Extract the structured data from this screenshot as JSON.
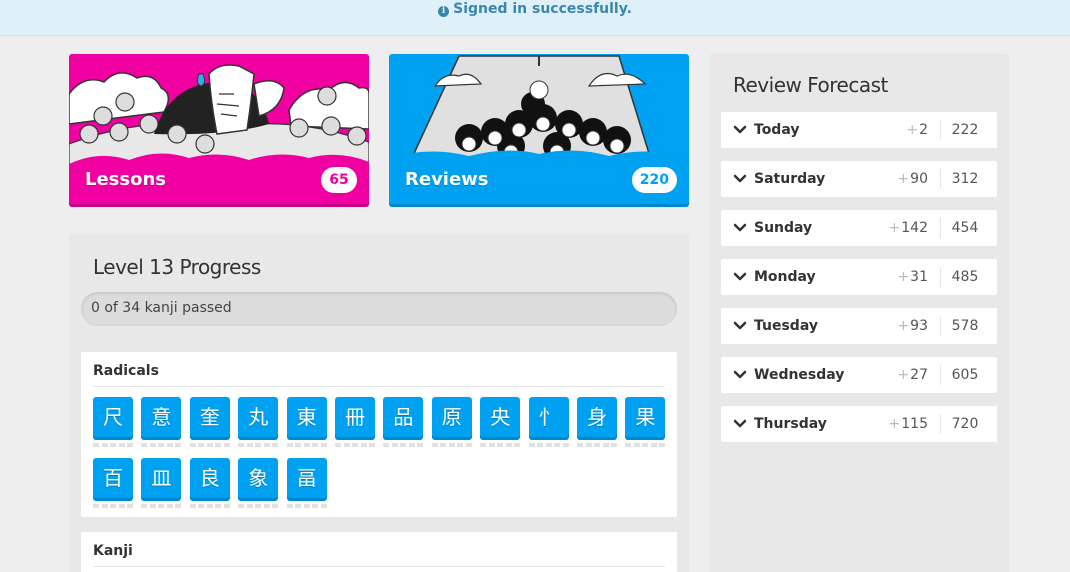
{
  "alert": {
    "text": "Signed in successfully.",
    "icon": "info-icon"
  },
  "lessons": {
    "label": "Lessons",
    "count": "65",
    "color": "#f100a1"
  },
  "reviews": {
    "label": "Reviews",
    "count": "220",
    "color": "#00a1f1"
  },
  "level_progress": {
    "title": "Level 13 Progress",
    "progress_text": "0 of 34 kanji passed",
    "progress_fraction": 0,
    "radicals_heading": "Radicals",
    "radicals": [
      "尺",
      "意",
      "奎",
      "丸",
      "東",
      "冊",
      "品",
      "原",
      "央",
      "忄",
      "身",
      "果",
      "百",
      "⽫",
      "良",
      "象",
      "畐"
    ],
    "kanji_heading": "Kanji",
    "radical_color": "#00a1f1"
  },
  "forecast": {
    "title": "Review Forecast",
    "rows": [
      {
        "day": "Today",
        "new": "2",
        "total": "222"
      },
      {
        "day": "Saturday",
        "new": "90",
        "total": "312"
      },
      {
        "day": "Sunday",
        "new": "142",
        "total": "454"
      },
      {
        "day": "Monday",
        "new": "31",
        "total": "485"
      },
      {
        "day": "Tuesday",
        "new": "93",
        "total": "578"
      },
      {
        "day": "Wednesday",
        "new": "27",
        "total": "605"
      },
      {
        "day": "Thursday",
        "new": "115",
        "total": "720"
      }
    ]
  }
}
